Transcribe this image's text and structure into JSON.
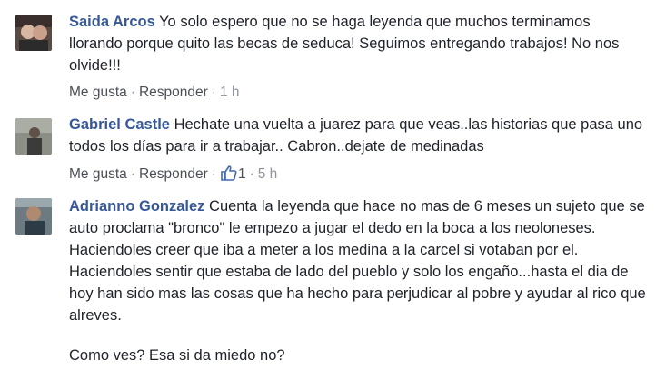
{
  "comments": [
    {
      "author": "Saida Arcos",
      "text": "Yo solo espero que no se haga leyenda que muchos terminamos llorando porque quito las becas de seduca! Seguimos entregando trabajos! No nos olvide!!!",
      "like_label": "Me gusta",
      "reply_label": "Responder",
      "time": "1 h"
    },
    {
      "author": "Gabriel Castle",
      "text": "Hechate una vuelta a juarez para que veas..las historias que pasa uno todos los días para ir a trabajar.. Cabron..dejate de medinadas",
      "like_label": "Me gusta",
      "reply_label": "Responder",
      "reactions": "1",
      "time": "5 h"
    },
    {
      "author": "Adrianno Gonzalez",
      "text": "Cuenta la leyenda que hace no mas de 6 meses un sujeto que se auto proclama \"bronco\" le empezo a jugar el dedo en la boca a los neoloneses. Haciendoles creer que iba a meter a los medina a la carcel si votaban por el. Haciendoles sentir que estaba de lado del pueblo y solo los engaño...hasta el dia de hoy han sido mas las cosas que ha hecho para perjudicar al pobre y ayudar al rico que alreves.",
      "text_2": "Como ves? Esa si da miedo no?"
    }
  ],
  "colors": {
    "author": "#365899",
    "text": "#1d2129",
    "meta": "#90949c",
    "like_blue": "#4267b2"
  },
  "icons": {
    "like": "thumbs-up-icon"
  }
}
